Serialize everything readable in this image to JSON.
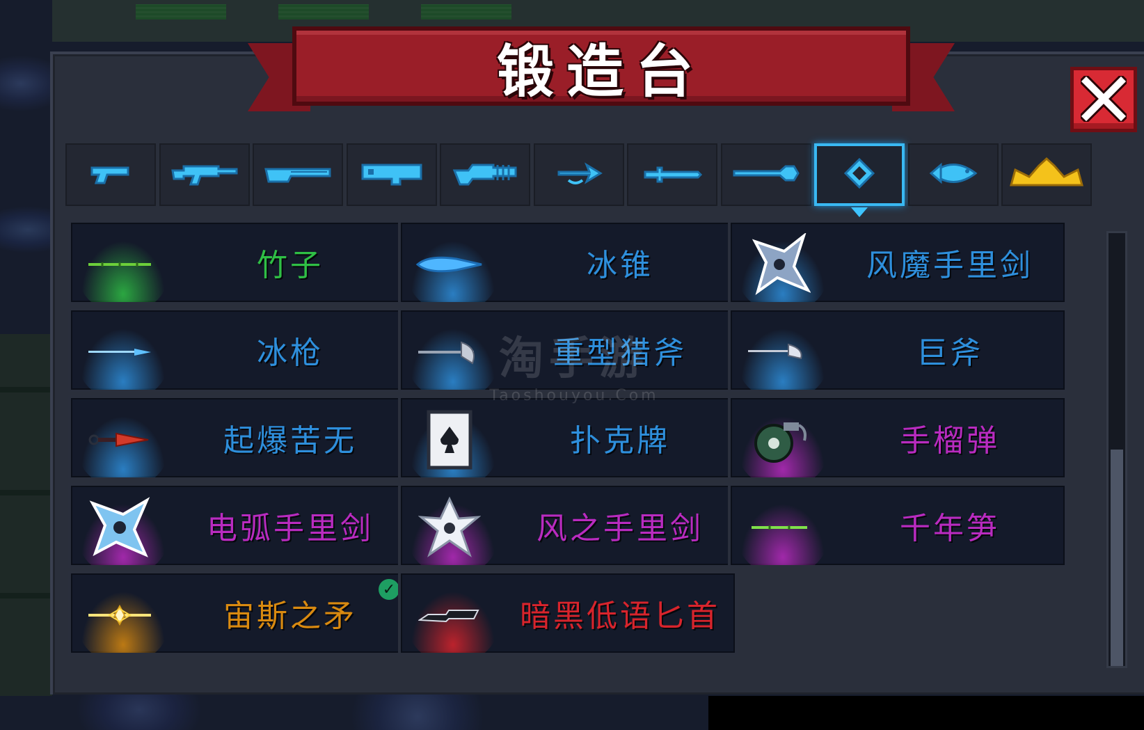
{
  "title": "锻造台",
  "watermark": {
    "title": "淘手游",
    "url": "Taoshouyou.Com"
  },
  "colors": {
    "common": "#2fbf45",
    "blue": "#2e8fdc",
    "purple": "#b92bc0",
    "gold": "#d98a10",
    "red": "#d8242c",
    "accent": "#3ec4ff"
  },
  "tabs": [
    {
      "icon": "pistol-icon"
    },
    {
      "icon": "rifle-icon"
    },
    {
      "icon": "shotgun-icon"
    },
    {
      "icon": "launcher-icon"
    },
    {
      "icon": "laser-gun-icon"
    },
    {
      "icon": "bow-icon"
    },
    {
      "icon": "sword-icon"
    },
    {
      "icon": "spear-icon"
    },
    {
      "icon": "throwing-icon",
      "selected": true
    },
    {
      "icon": "fish-icon"
    },
    {
      "icon": "crown-icon"
    }
  ],
  "weapons": [
    {
      "name": "竹子",
      "rarity": "common",
      "icon": "bamboo-icon"
    },
    {
      "name": "冰锥",
      "rarity": "blue",
      "icon": "icicle-icon"
    },
    {
      "name": "风魔手里剑",
      "rarity": "blue",
      "icon": "shuriken-icon"
    },
    {
      "name": "冰枪",
      "rarity": "blue",
      "icon": "ice-spear-icon"
    },
    {
      "name": "重型猎斧",
      "rarity": "blue",
      "icon": "heavy-axe-icon"
    },
    {
      "name": "巨斧",
      "rarity": "blue",
      "icon": "giant-axe-icon"
    },
    {
      "name": "起爆苦无",
      "rarity": "blue",
      "icon": "kunai-icon"
    },
    {
      "name": "扑克牌",
      "rarity": "blue",
      "icon": "playing-card-icon"
    },
    {
      "name": "手榴弹",
      "rarity": "purple",
      "icon": "grenade-icon"
    },
    {
      "name": "电弧手里剑",
      "rarity": "purple",
      "icon": "arc-shuriken-icon"
    },
    {
      "name": "风之手里剑",
      "rarity": "purple",
      "icon": "wind-shuriken-icon"
    },
    {
      "name": "千年笋",
      "rarity": "purple",
      "icon": "bamboo-shoot-icon"
    },
    {
      "name": "宙斯之矛",
      "rarity": "gold",
      "icon": "zeus-spear-icon",
      "owned": true
    },
    {
      "name": "暗黑低语匕首",
      "rarity": "red",
      "icon": "dark-dagger-icon"
    }
  ],
  "scroll": {
    "position": 0.45,
    "visible_fraction": 0.5
  }
}
